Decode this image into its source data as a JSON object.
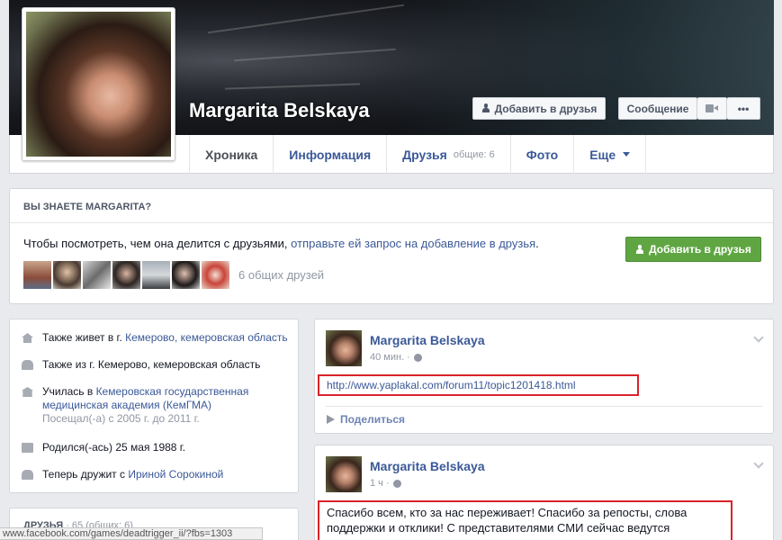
{
  "profile": {
    "name": "Margarita Belskaya",
    "add_friend_label": "Добавить в друзья",
    "message_label": "Сообщение",
    "more_label": "•••"
  },
  "tabs": [
    {
      "label": "Хроника"
    },
    {
      "label": "Информация"
    },
    {
      "label": "Друзья",
      "sub": "общие: 6"
    },
    {
      "label": "Фото"
    },
    {
      "label": "Еще"
    }
  ],
  "know": {
    "title": "ВЫ ЗНАЕТЕ MARGARITA?",
    "text": "Чтобы посмотреть, чем она делится с друзьями, ",
    "link": "отправьте ей запрос на добавление в друзья",
    "text_end": ".",
    "button": "Добавить в друзья",
    "mutual": "6 общих друзей"
  },
  "about": {
    "lives_prefix": "Также живет в г. ",
    "lives_link": "Кемерово, кемеровская область",
    "from": "Также из г. Кемерово, кемеровская область",
    "study_prefix": "Училась в ",
    "study_link": "Кемеровская государственная медицинская академия (КемГМА)",
    "study_years": "Посещал(-а) с 2005 г. до 2011 г.",
    "born": "Родился(-ась) 25 мая 1988 г.",
    "friends_prefix": "Теперь дружит с ",
    "friends_link": "Ириной Сорокиной"
  },
  "friends_card": {
    "title": "ДРУЗЬЯ",
    "count": " · 65 (общих: 6)"
  },
  "status_url": "www.facebook.com/games/deadtrigger_ii/?fbs=1303",
  "posts": [
    {
      "author": "Margarita Belskaya",
      "time": "40 мин. ·",
      "link": "http://www.yaplakal.com/forum11/topic1201418.html",
      "share": "Поделиться"
    },
    {
      "author": "Margarita Belskaya",
      "time": "1 ч ·",
      "text": "Спасибо всем, кто за нас переживает! Спасибо за репосты, слова поддержки и отклики! С представителями СМИ сейчас ведутся"
    }
  ]
}
